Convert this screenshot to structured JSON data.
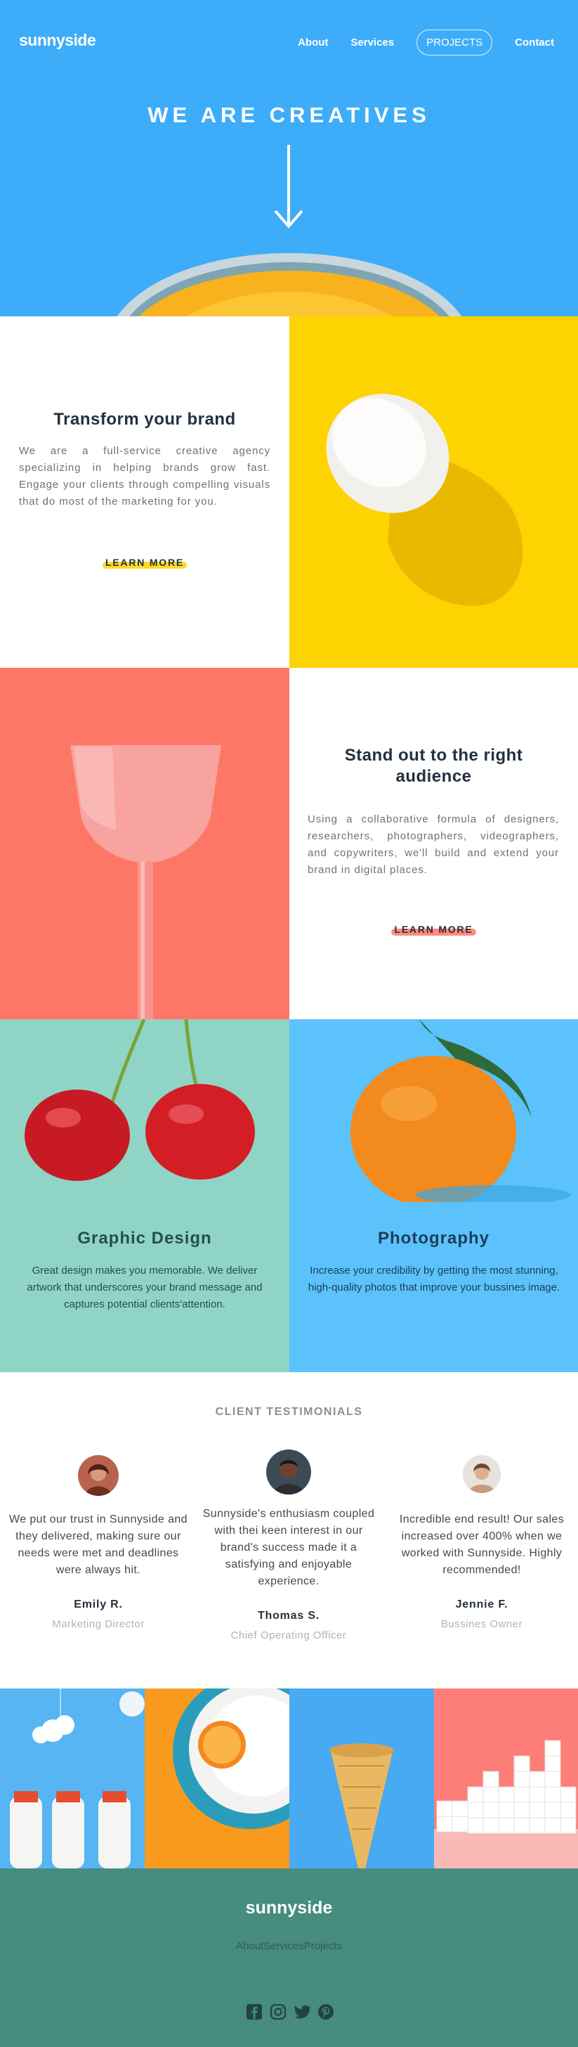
{
  "header": {
    "logo": "sunnyside",
    "nav": {
      "about": "About",
      "services": "Services",
      "projects": "PROJECTS",
      "contact": "Contact"
    }
  },
  "hero": {
    "title": "WE ARE CREATIVES"
  },
  "transform": {
    "title": "Transform your brand",
    "body": "We are a full-service creative agency specializing in helping brands grow fast. Engage your clients through compelling visuals that do most of the marketing for you.",
    "cta": "LEARN MORE"
  },
  "standout": {
    "title": "Stand out to the right audience",
    "body": "Using a collaborative formula of designers, researchers, photographers, videographers, and copywriters, we'll build and extend your brand in digital places.",
    "cta": "LEARN MORE"
  },
  "graphic": {
    "title": "Graphic Design",
    "body": "Great design makes you memorable. We deliver artwork that underscores your brand message and captures potential clients'attention."
  },
  "photography": {
    "title": "Photography",
    "body": "Increase your credibility by getting the most stunning, high-quality photos that improve your bussines image."
  },
  "testimonials": {
    "heading": "CLIENT TESTIMONIALS",
    "items": [
      {
        "quote": "We put our trust in Sunnyside and they delivered, making sure our needs were met and deadlines were always hit.",
        "name": "Emily R.",
        "role": "Marketing Director"
      },
      {
        "quote": "Sunnyside's enthusiasm coupled with thei keen interest in our brand's success made it a satisfying and enjoyable experience.",
        "name": "Thomas S.",
        "role": "Chief Operating Officer"
      },
      {
        "quote": "Incredible end result! Our sales increased over 400% when we worked with Sunnyside. Highly recommended!",
        "name": "Jennie F.",
        "role": "Bussines Owner"
      }
    ]
  },
  "footer": {
    "logo": "sunnyside",
    "links": [
      "About",
      "Services",
      "Projects"
    ],
    "socials": [
      "facebook-icon",
      "instagram-icon",
      "twitter-icon",
      "pinterest-icon"
    ]
  },
  "colors": {
    "hero_blue": "#3dadf9",
    "yellow": "#fad400",
    "coral": "#fe7766",
    "mint": "#90d4c5",
    "footer_green": "#468c7f"
  }
}
